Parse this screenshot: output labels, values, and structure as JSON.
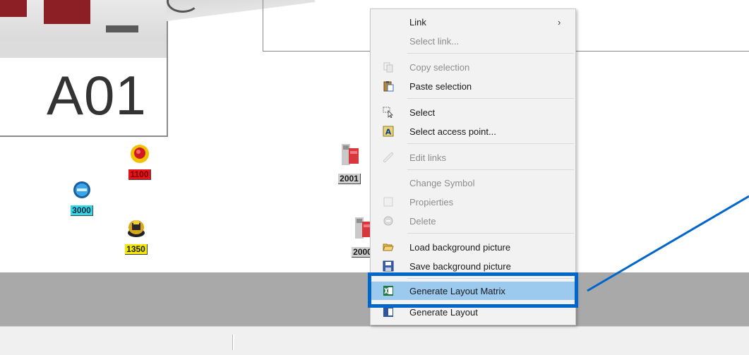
{
  "canvas": {
    "panel_label": "A01",
    "devices": [
      {
        "id": "d1100",
        "label": "1100",
        "label_bg": "#e8101a",
        "label_color": "#7a0a0a"
      },
      {
        "id": "d3000",
        "label": "3000",
        "label_bg": "#35d6e6",
        "label_color": "#0a2a40"
      },
      {
        "id": "d1350",
        "label": "1350",
        "label_bg": "#f5e800",
        "label_color": "#1a1a1a"
      },
      {
        "id": "d2001",
        "label": "2001",
        "label_bg": "#cfcfcf",
        "label_color": "#1a1a1a"
      },
      {
        "id": "d2000",
        "label": "2000",
        "label_bg": "#cfcfcf",
        "label_color": "#1a1a1a"
      }
    ]
  },
  "context_menu": {
    "items": {
      "link": {
        "label": "Link",
        "submenu_arrow": "›"
      },
      "select_link": {
        "label": "Select link..."
      },
      "copy_selection": {
        "label": "Copy selection"
      },
      "paste_selection": {
        "label": "Paste selection"
      },
      "select": {
        "label": "Select"
      },
      "select_access_point": {
        "label": "Select access point..."
      },
      "edit_links": {
        "label": "Edit links"
      },
      "change_symbol": {
        "label": "Change Symbol"
      },
      "properties": {
        "label": "Propierties"
      },
      "delete": {
        "label": "Delete"
      },
      "load_background": {
        "label": "Load background picture"
      },
      "save_background": {
        "label": "Save background picture"
      },
      "generate_layout_matrix": {
        "label": "Generate Layout Matrix"
      },
      "generate_layout": {
        "label": "Generate Layout"
      }
    }
  },
  "colors": {
    "highlight": "#9cc9ee",
    "callout": "#0066cc"
  }
}
